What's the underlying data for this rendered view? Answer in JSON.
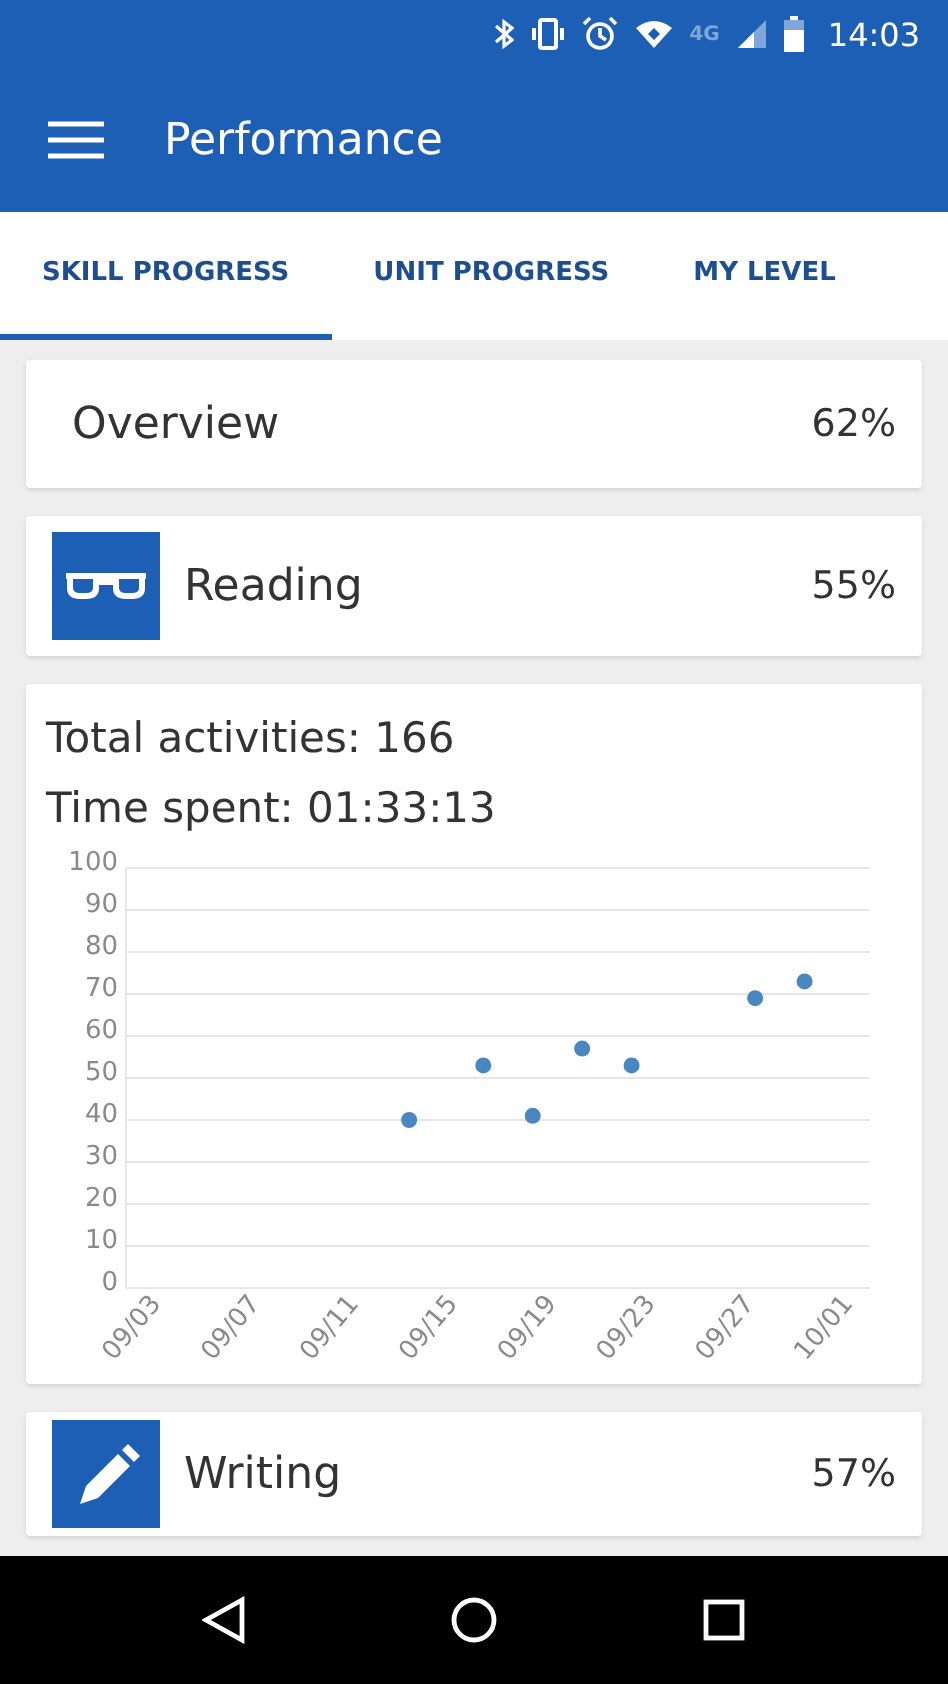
{
  "status_bar": {
    "time": "14:03",
    "network": "4G"
  },
  "app_bar": {
    "title": "Performance"
  },
  "tabs": [
    {
      "label": "SKILL PROGRESS",
      "selected": true
    },
    {
      "label": "UNIT PROGRESS",
      "selected": false
    },
    {
      "label": "MY LEVEL",
      "selected": false
    }
  ],
  "overview": {
    "label": "Overview",
    "value": "62%"
  },
  "skills": [
    {
      "kind": "reading",
      "label": "Reading",
      "value": "55%"
    }
  ],
  "stats": {
    "total_activities": "Total activities: 166",
    "time_spent": "Time spent: 01:33:13",
    "chart_data": {
      "type": "scatter",
      "categories": [
        "09/03",
        null,
        null,
        null,
        "09/07",
        null,
        null,
        null,
        "09/11",
        null,
        null,
        null,
        "09/15",
        null,
        null,
        null,
        "09/19",
        null,
        null,
        null,
        "09/23",
        null,
        null,
        null,
        "09/27",
        null,
        null,
        null,
        "10/01"
      ],
      "series": [
        {
          "color": "#4a86c0",
          "values": [
            null,
            null,
            null,
            null,
            null,
            null,
            null,
            null,
            null,
            null,
            40,
            null,
            null,
            53,
            null,
            41,
            null,
            57,
            null,
            53,
            null,
            null,
            null,
            null,
            69,
            null,
            73,
            null,
            null
          ]
        }
      ],
      "ylim": [
        0,
        100
      ],
      "grid": true,
      "yticks": [
        0,
        10,
        20,
        30,
        40,
        50,
        60,
        70,
        80,
        90,
        100
      ]
    }
  },
  "more_skills": [
    {
      "kind": "writing",
      "label": "Writing",
      "value": "57%"
    }
  ]
}
